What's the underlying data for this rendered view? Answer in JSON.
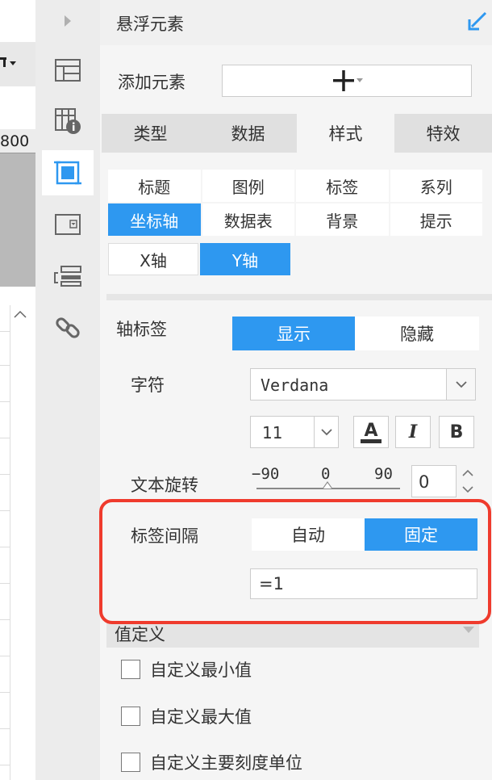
{
  "canvas": {
    "ruler_label": "800"
  },
  "icon_bar": {
    "items": [
      {
        "name": "layout-grid-icon"
      },
      {
        "name": "table-info-icon"
      },
      {
        "name": "frame-select-icon"
      },
      {
        "name": "dropdown-widget-icon"
      },
      {
        "name": "list-stack-icon"
      },
      {
        "name": "link-icon"
      }
    ]
  },
  "panel": {
    "title": "悬浮元素",
    "add_element_label": "添加元素",
    "main_tabs": [
      {
        "label": "类型",
        "active": false
      },
      {
        "label": "数据",
        "active": false
      },
      {
        "label": "样式",
        "active": true
      },
      {
        "label": "特效",
        "active": false
      }
    ],
    "sub_tabs": [
      {
        "label": "标题",
        "active": false
      },
      {
        "label": "图例",
        "active": false
      },
      {
        "label": "标签",
        "active": false
      },
      {
        "label": "系列",
        "active": false
      },
      {
        "label": "坐标轴",
        "active": true
      },
      {
        "label": "数据表",
        "active": false
      },
      {
        "label": "背景",
        "active": false
      },
      {
        "label": "提示",
        "active": false
      }
    ],
    "axis_tabs": [
      {
        "label": "X轴",
        "active": false
      },
      {
        "label": "Y轴",
        "active": true
      }
    ],
    "axis_label": {
      "label": "轴标签",
      "show": "显示",
      "hide": "隐藏",
      "selected": "显示"
    },
    "font": {
      "label": "字符",
      "family": "Verdana",
      "size": "11",
      "color_btn": "A",
      "italic_btn": "I",
      "bold_btn": "B"
    },
    "rotation": {
      "label": "文本旋转",
      "tick_min": "−90",
      "tick_mid": "0",
      "tick_max": "90",
      "value": "0"
    },
    "interval": {
      "label": "标签间隔",
      "auto": "自动",
      "fixed": "固定",
      "selected": "固定",
      "value": "=1"
    },
    "custom": {
      "header": "值定义",
      "options": [
        {
          "label": "自定义最小值",
          "checked": false
        },
        {
          "label": "自定义最大值",
          "checked": false
        },
        {
          "label": "自定义主要刻度单位",
          "checked": false
        }
      ]
    }
  },
  "colors": {
    "accent": "#2e98f0",
    "highlight": "#ef3b2d"
  }
}
